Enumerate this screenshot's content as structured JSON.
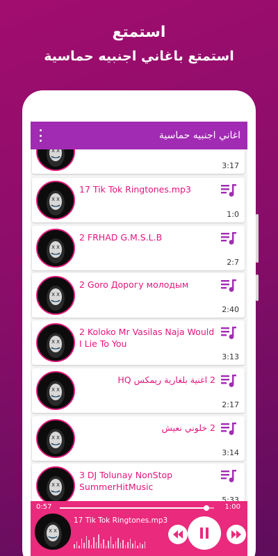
{
  "promo": {
    "title": "استمتع",
    "subtitle": "استمتع باغاني اجنبيه حماسية"
  },
  "appbar": {
    "title": "اغاني اجنبيه حماسية",
    "menu_icon": "more-vert-icon"
  },
  "colors": {
    "accent": "#e4147c",
    "appbar": "#a12bb3",
    "player": "#ea2a7c",
    "background": "#8a0d6a"
  },
  "songs": [
    {
      "title": "",
      "duration": "3:17"
    },
    {
      "title": "17  Tik Tok Ringtones.mp3",
      "duration": "1:0"
    },
    {
      "title": "2 FRHAD   G.M.S.L.B",
      "duration": "2:7"
    },
    {
      "title": "2 Goro   Дорогу молодым",
      "duration": "2:40"
    },
    {
      "title": "2 Koloko   Mr Vasilas Naja   Would I Lie To You",
      "duration": "3:13"
    },
    {
      "title": "2 اغنية بلغارية ريمكس HQ",
      "duration": "2:17"
    },
    {
      "title": "2 خلوني نعيش",
      "duration": "3:14"
    },
    {
      "title": "3 DJ Tolunay   NonStop SummerHitMusic",
      "duration": "5:33"
    }
  ],
  "player": {
    "current_time": "0:57",
    "total_time": "1:00",
    "progress": 0.95,
    "track_title": "17  Tik Tok Ringtones.mp3",
    "prev_icon": "skip-previous-icon",
    "pause_icon": "pause-icon",
    "next_icon": "skip-next-icon"
  }
}
